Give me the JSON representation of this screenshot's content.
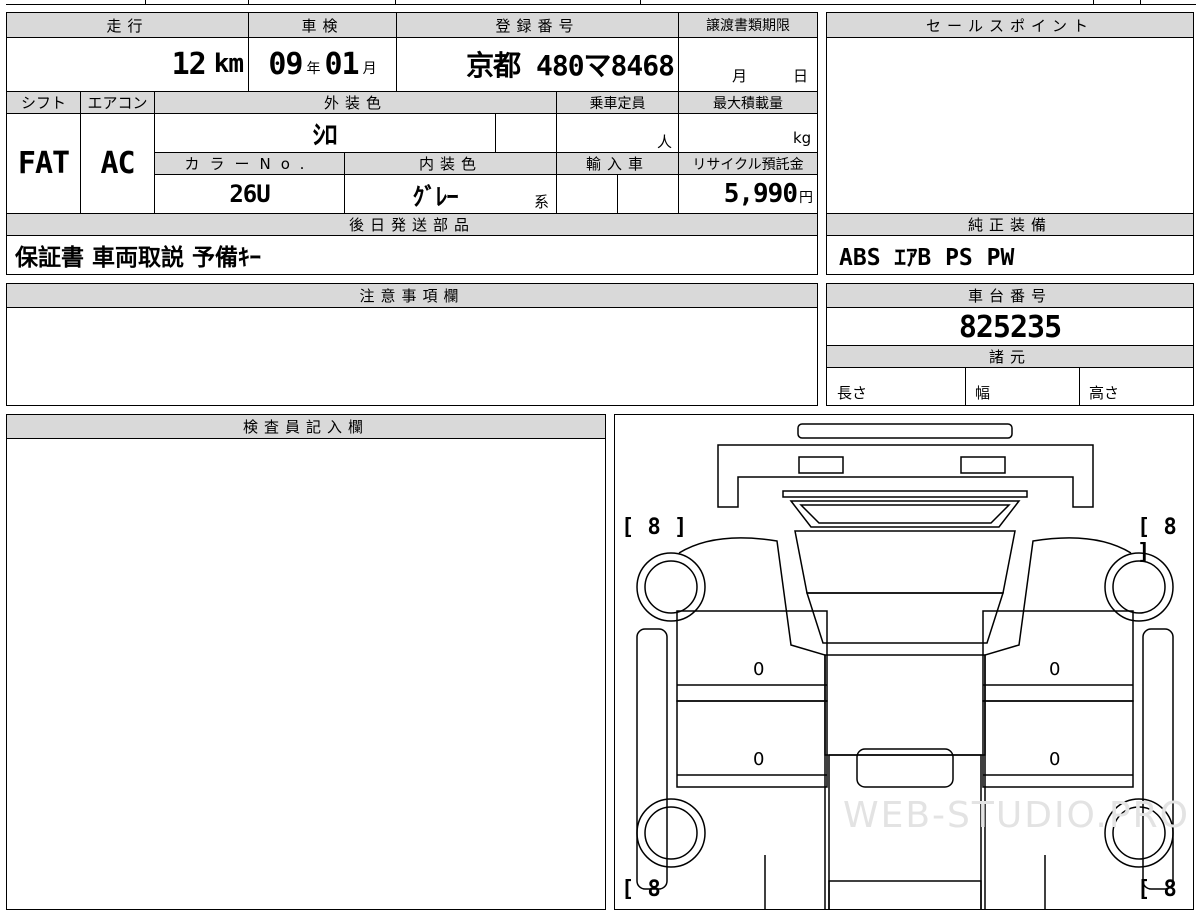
{
  "vehicle": {
    "mileage_header": "走行",
    "mileage_value": "12",
    "mileage_unit": "km",
    "inspection_header": "車検",
    "inspection_year": "09",
    "inspection_year_unit": "年",
    "inspection_month": "01",
    "inspection_month_unit": "月",
    "registration_header": "登録番号",
    "registration_value": "京都 480マ8468",
    "transfer_header": "譲渡書類期限",
    "transfer_month_unit": "月",
    "transfer_day_unit": "日",
    "shift_header": "シフト",
    "shift_value": "FAT",
    "ac_header": "エアコン",
    "ac_value": "AC",
    "exterior_header": "外装色",
    "exterior_value": "ｼﾛ",
    "capacity_header": "乗車定員",
    "capacity_unit": "人",
    "load_header": "最大積載量",
    "load_unit": "kg",
    "color_no_header": "カラーNo.",
    "color_no_value": "26U",
    "interior_header": "内装色",
    "interior_value": "ｸﾞﾚｰ",
    "interior_suffix": "系",
    "import_header": "輸入車",
    "recycle_header": "リサイクル預託金",
    "recycle_value": "5,990",
    "recycle_unit": "円",
    "later_parts_header": "後日発送部品",
    "later_parts_value": "保証書 車両取説 予備ｷｰ"
  },
  "sales": {
    "sales_point_header": "セールスポイント",
    "standard_equipment_header": "純正装備",
    "standard_equipment_value": "ABS ｴｱB PS PW",
    "chassis_header": "車台番号",
    "chassis_value": "825235",
    "specs_header": "諸元",
    "length_label": "長さ",
    "width_label": "幅",
    "height_label": "高さ"
  },
  "notes": {
    "caution_header": "注意事項欄",
    "inspector_header": "検査員記入欄"
  },
  "diagram": {
    "tire_fl": "[ 8 ]",
    "tire_fr": "[ 8 ]",
    "tire_rl": "[ 8",
    "tire_rr": "[ 8",
    "panel_mark": "0",
    "watermark": "WEB-STUDIO.PRO"
  }
}
